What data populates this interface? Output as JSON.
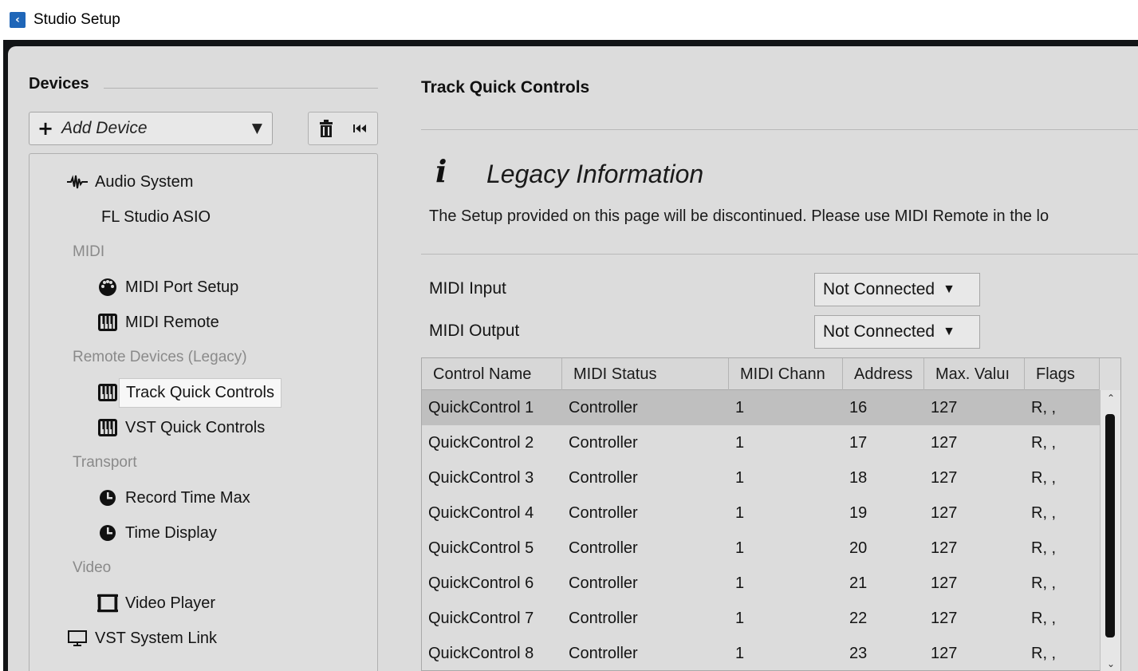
{
  "window": {
    "title": "Studio Setup",
    "icon": "back-arrow-icon"
  },
  "devices": {
    "heading": "Devices",
    "add_device_label": "Add Device",
    "tree": [
      {
        "type": "item",
        "label": "Audio System",
        "icon": "waveform-icon"
      },
      {
        "type": "item",
        "label": "FL Studio ASIO",
        "icon": ""
      },
      {
        "type": "group",
        "label": "MIDI"
      },
      {
        "type": "item",
        "label": "MIDI Port Setup",
        "icon": "midi-din-icon"
      },
      {
        "type": "item",
        "label": "MIDI Remote",
        "icon": "keyboard-icon"
      },
      {
        "type": "group",
        "label": "Remote Devices (Legacy)"
      },
      {
        "type": "item",
        "label": "Track Quick Controls",
        "icon": "keyboard-icon",
        "selected": true
      },
      {
        "type": "item",
        "label": "VST Quick Controls",
        "icon": "keyboard-icon"
      },
      {
        "type": "group",
        "label": "Transport"
      },
      {
        "type": "item",
        "label": "Record Time Max",
        "icon": "clock-icon"
      },
      {
        "type": "item",
        "label": "Time Display",
        "icon": "clock-icon"
      },
      {
        "type": "group",
        "label": "Video"
      },
      {
        "type": "item",
        "label": "Video Player",
        "icon": "film-icon"
      },
      {
        "type": "item",
        "label": "VST System Link",
        "icon": "monitor-icon"
      }
    ]
  },
  "main": {
    "title": "Track Quick Controls",
    "legacy": {
      "title": "Legacy Information",
      "text": "The Setup provided on this page will be discontinued. Please use MIDI Remote in the lo"
    },
    "midi_input": {
      "label": "MIDI Input",
      "value": "Not Connected"
    },
    "midi_output": {
      "label": "MIDI Output",
      "value": "Not Connected"
    },
    "table": {
      "columns": [
        "Control Name",
        "MIDI Status",
        "MIDI Chann",
        "Address",
        "Max. Valuı",
        "Flags"
      ],
      "rows": [
        [
          "QuickControl 1",
          "Controller",
          "1",
          "16",
          "127",
          "R, ,"
        ],
        [
          "QuickControl 2",
          "Controller",
          "1",
          "17",
          "127",
          "R, ,"
        ],
        [
          "QuickControl 3",
          "Controller",
          "1",
          "18",
          "127",
          "R, ,"
        ],
        [
          "QuickControl 4",
          "Controller",
          "1",
          "19",
          "127",
          "R, ,"
        ],
        [
          "QuickControl 5",
          "Controller",
          "1",
          "20",
          "127",
          "R, ,"
        ],
        [
          "QuickControl 6",
          "Controller",
          "1",
          "21",
          "127",
          "R, ,"
        ],
        [
          "QuickControl 7",
          "Controller",
          "1",
          "22",
          "127",
          "R, ,"
        ],
        [
          "QuickControl 8",
          "Controller",
          "1",
          "23",
          "127",
          "R, ,"
        ]
      ],
      "selected_row": 0
    }
  },
  "colors": {
    "panel": "#dcdcdc",
    "frame": "#121416",
    "app_icon": "#1f66b8",
    "selected_row": "#bfbfbf"
  }
}
